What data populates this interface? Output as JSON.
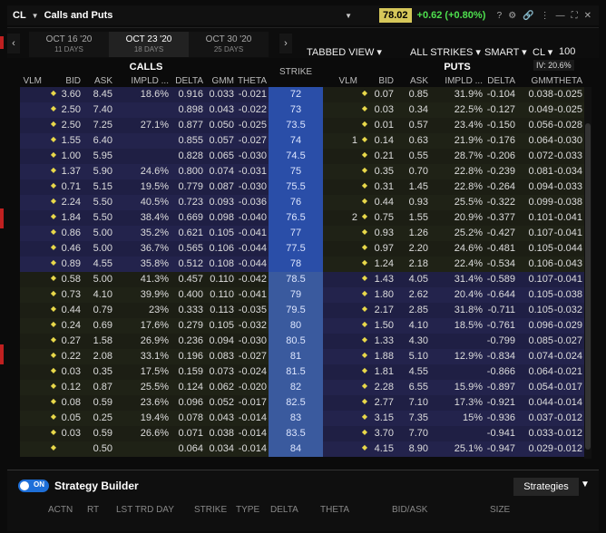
{
  "titlebar": {
    "symbol": "CL",
    "title": "Calls and Puts",
    "price": "78.02",
    "change": "+0.62 (+0.80%)"
  },
  "tabs": [
    {
      "date": "OCT 16 '20",
      "days": "11 DAYS",
      "active": false
    },
    {
      "date": "OCT 23 '20",
      "days": "18 DAYS",
      "active": true
    },
    {
      "date": "OCT 30 '20",
      "days": "25 DAYS",
      "active": false
    }
  ],
  "controls": {
    "view": "TABBED VIEW",
    "strikes": "ALL STRIKES",
    "exchange": "SMART",
    "underlying": "CL",
    "multiplier": "100",
    "iv": "IV: 20.6%"
  },
  "sections": {
    "calls": "CALLS",
    "strike": "STRIKE",
    "puts": "PUTS"
  },
  "headers": {
    "calls": [
      "VLM",
      "BID",
      "ASK",
      "IMPLD ...",
      "DELTA",
      "GMM",
      "THETA"
    ],
    "puts": [
      "VLM",
      "BID",
      "ASK",
      "IMPLD ...",
      "DELTA",
      "GMM",
      "THETA"
    ]
  },
  "rows": [
    {
      "c_bid": "3.60",
      "c_ask": "8.45",
      "c_iv": "18.6%",
      "c_delta": "0.916",
      "c_gmm": "0.033",
      "c_theta": "-0.021",
      "strike": "72",
      "p_vlm": "",
      "p_bid": "0.07",
      "p_ask": "0.85",
      "p_iv": "31.9%",
      "p_delta": "-0.104",
      "p_gmm": "0.038",
      "p_theta": "-0.025",
      "itm": true
    },
    {
      "c_bid": "2.50",
      "c_ask": "7.40",
      "c_iv": "",
      "c_delta": "0.898",
      "c_gmm": "0.043",
      "c_theta": "-0.022",
      "strike": "73",
      "p_vlm": "",
      "p_bid": "0.03",
      "p_ask": "0.34",
      "p_iv": "22.5%",
      "p_delta": "-0.127",
      "p_gmm": "0.049",
      "p_theta": "-0.025",
      "itm": true
    },
    {
      "c_bid": "2.50",
      "c_ask": "7.25",
      "c_iv": "27.1%",
      "c_delta": "0.877",
      "c_gmm": "0.050",
      "c_theta": "-0.025",
      "strike": "73.5",
      "p_vlm": "",
      "p_bid": "0.01",
      "p_ask": "0.57",
      "p_iv": "23.4%",
      "p_delta": "-0.150",
      "p_gmm": "0.056",
      "p_theta": "-0.028",
      "itm": true
    },
    {
      "c_bid": "1.55",
      "c_ask": "6.40",
      "c_iv": "",
      "c_delta": "0.855",
      "c_gmm": "0.057",
      "c_theta": "-0.027",
      "strike": "74",
      "p_vlm": "1",
      "p_bid": "0.14",
      "p_ask": "0.63",
      "p_iv": "21.9%",
      "p_delta": "-0.176",
      "p_gmm": "0.064",
      "p_theta": "-0.030",
      "itm": true
    },
    {
      "c_bid": "1.00",
      "c_ask": "5.95",
      "c_iv": "",
      "c_delta": "0.828",
      "c_gmm": "0.065",
      "c_theta": "-0.030",
      "strike": "74.5",
      "p_vlm": "",
      "p_bid": "0.21",
      "p_ask": "0.55",
      "p_iv": "28.7%",
      "p_delta": "-0.206",
      "p_gmm": "0.072",
      "p_theta": "-0.033",
      "itm": true
    },
    {
      "c_bid": "1.37",
      "c_ask": "5.90",
      "c_iv": "24.6%",
      "c_delta": "0.800",
      "c_gmm": "0.074",
      "c_theta": "-0.031",
      "strike": "75",
      "p_vlm": "",
      "p_bid": "0.35",
      "p_ask": "0.70",
      "p_iv": "22.8%",
      "p_delta": "-0.239",
      "p_gmm": "0.081",
      "p_theta": "-0.034",
      "itm": true
    },
    {
      "c_bid": "0.71",
      "c_ask": "5.15",
      "c_iv": "19.5%",
      "c_delta": "0.779",
      "c_gmm": "0.087",
      "c_theta": "-0.030",
      "strike": "75.5",
      "p_vlm": "",
      "p_bid": "0.31",
      "p_ask": "1.45",
      "p_iv": "22.8%",
      "p_delta": "-0.264",
      "p_gmm": "0.094",
      "p_theta": "-0.033",
      "itm": true
    },
    {
      "c_bid": "2.24",
      "c_ask": "5.50",
      "c_iv": "40.5%",
      "c_delta": "0.723",
      "c_gmm": "0.093",
      "c_theta": "-0.036",
      "strike": "76",
      "p_vlm": "",
      "p_bid": "0.44",
      "p_ask": "0.93",
      "p_iv": "25.5%",
      "p_delta": "-0.322",
      "p_gmm": "0.099",
      "p_theta": "-0.038",
      "itm": true
    },
    {
      "c_bid": "1.84",
      "c_ask": "5.50",
      "c_iv": "38.4%",
      "c_delta": "0.669",
      "c_gmm": "0.098",
      "c_theta": "-0.040",
      "strike": "76.5",
      "p_vlm": "2",
      "p_bid": "0.75",
      "p_ask": "1.55",
      "p_iv": "20.9%",
      "p_delta": "-0.377",
      "p_gmm": "0.101",
      "p_theta": "-0.041",
      "itm": true
    },
    {
      "c_bid": "0.86",
      "c_ask": "5.00",
      "c_iv": "35.2%",
      "c_delta": "0.621",
      "c_gmm": "0.105",
      "c_theta": "-0.041",
      "strike": "77",
      "p_vlm": "",
      "p_bid": "0.93",
      "p_ask": "1.26",
      "p_iv": "25.2%",
      "p_delta": "-0.427",
      "p_gmm": "0.107",
      "p_theta": "-0.041",
      "itm": true
    },
    {
      "c_bid": "0.46",
      "c_ask": "5.00",
      "c_iv": "36.7%",
      "c_delta": "0.565",
      "c_gmm": "0.106",
      "c_theta": "-0.044",
      "strike": "77.5",
      "p_vlm": "",
      "p_bid": "0.97",
      "p_ask": "2.20",
      "p_iv": "24.6%",
      "p_delta": "-0.481",
      "p_gmm": "0.105",
      "p_theta": "-0.044",
      "itm": true
    },
    {
      "c_bid": "0.89",
      "c_ask": "4.55",
      "c_iv": "35.8%",
      "c_delta": "0.512",
      "c_gmm": "0.108",
      "c_theta": "-0.044",
      "strike": "78",
      "p_vlm": "",
      "p_bid": "1.24",
      "p_ask": "2.18",
      "p_iv": "22.4%",
      "p_delta": "-0.534",
      "p_gmm": "0.106",
      "p_theta": "-0.043",
      "itm": true
    },
    {
      "c_bid": "0.58",
      "c_ask": "5.00",
      "c_iv": "41.3%",
      "c_delta": "0.457",
      "c_gmm": "0.110",
      "c_theta": "-0.042",
      "strike": "78.5",
      "p_vlm": "",
      "p_bid": "1.43",
      "p_ask": "4.05",
      "p_iv": "31.4%",
      "p_delta": "-0.589",
      "p_gmm": "0.107",
      "p_theta": "-0.041",
      "itm": false
    },
    {
      "c_bid": "0.73",
      "c_ask": "4.10",
      "c_iv": "39.9%",
      "c_delta": "0.400",
      "c_gmm": "0.110",
      "c_theta": "-0.041",
      "strike": "79",
      "p_vlm": "",
      "p_bid": "1.80",
      "p_ask": "2.62",
      "p_iv": "20.4%",
      "p_delta": "-0.644",
      "p_gmm": "0.105",
      "p_theta": "-0.038",
      "itm": false
    },
    {
      "c_bid": "0.44",
      "c_ask": "0.79",
      "c_iv": "23%",
      "c_delta": "0.333",
      "c_gmm": "0.113",
      "c_theta": "-0.035",
      "strike": "79.5",
      "p_vlm": "",
      "p_bid": "2.17",
      "p_ask": "2.85",
      "p_iv": "31.8%",
      "p_delta": "-0.711",
      "p_gmm": "0.105",
      "p_theta": "-0.032",
      "itm": false
    },
    {
      "c_bid": "0.24",
      "c_ask": "0.69",
      "c_iv": "17.6%",
      "c_delta": "0.279",
      "c_gmm": "0.105",
      "c_theta": "-0.032",
      "strike": "80",
      "p_vlm": "",
      "p_bid": "1.50",
      "p_ask": "4.10",
      "p_iv": "18.5%",
      "p_delta": "-0.761",
      "p_gmm": "0.096",
      "p_theta": "-0.029",
      "itm": false
    },
    {
      "c_bid": "0.27",
      "c_ask": "1.58",
      "c_iv": "26.9%",
      "c_delta": "0.236",
      "c_gmm": "0.094",
      "c_theta": "-0.030",
      "strike": "80.5",
      "p_vlm": "",
      "p_bid": "1.33",
      "p_ask": "4.30",
      "p_iv": "",
      "p_delta": "-0.799",
      "p_gmm": "0.085",
      "p_theta": "-0.027",
      "itm": false
    },
    {
      "c_bid": "0.22",
      "c_ask": "2.08",
      "c_iv": "33.1%",
      "c_delta": "0.196",
      "c_gmm": "0.083",
      "c_theta": "-0.027",
      "strike": "81",
      "p_vlm": "",
      "p_bid": "1.88",
      "p_ask": "5.10",
      "p_iv": "12.9%",
      "p_delta": "-0.834",
      "p_gmm": "0.074",
      "p_theta": "-0.024",
      "itm": false
    },
    {
      "c_bid": "0.03",
      "c_ask": "0.35",
      "c_iv": "17.5%",
      "c_delta": "0.159",
      "c_gmm": "0.073",
      "c_theta": "-0.024",
      "strike": "81.5",
      "p_vlm": "",
      "p_bid": "1.81",
      "p_ask": "4.55",
      "p_iv": "",
      "p_delta": "-0.866",
      "p_gmm": "0.064",
      "p_theta": "-0.021",
      "itm": false
    },
    {
      "c_bid": "0.12",
      "c_ask": "0.87",
      "c_iv": "25.5%",
      "c_delta": "0.124",
      "c_gmm": "0.062",
      "c_theta": "-0.020",
      "strike": "82",
      "p_vlm": "",
      "p_bid": "2.28",
      "p_ask": "6.55",
      "p_iv": "15.9%",
      "p_delta": "-0.897",
      "p_gmm": "0.054",
      "p_theta": "-0.017",
      "itm": false
    },
    {
      "c_bid": "0.08",
      "c_ask": "0.59",
      "c_iv": "23.6%",
      "c_delta": "0.096",
      "c_gmm": "0.052",
      "c_theta": "-0.017",
      "strike": "82.5",
      "p_vlm": "",
      "p_bid": "2.77",
      "p_ask": "7.10",
      "p_iv": "17.3%",
      "p_delta": "-0.921",
      "p_gmm": "0.044",
      "p_theta": "-0.014",
      "itm": false
    },
    {
      "c_bid": "0.05",
      "c_ask": "0.25",
      "c_iv": "19.4%",
      "c_delta": "0.078",
      "c_gmm": "0.043",
      "c_theta": "-0.014",
      "strike": "83",
      "p_vlm": "",
      "p_bid": "3.15",
      "p_ask": "7.35",
      "p_iv": "15%",
      "p_delta": "-0.936",
      "p_gmm": "0.037",
      "p_theta": "-0.012",
      "itm": false
    },
    {
      "c_bid": "0.03",
      "c_ask": "0.59",
      "c_iv": "26.6%",
      "c_delta": "0.071",
      "c_gmm": "0.038",
      "c_theta": "-0.014",
      "strike": "83.5",
      "p_vlm": "",
      "p_bid": "3.70",
      "p_ask": "7.70",
      "p_iv": "",
      "p_delta": "-0.941",
      "p_gmm": "0.033",
      "p_theta": "-0.012",
      "itm": false
    },
    {
      "c_bid": "",
      "c_ask": "0.50",
      "c_iv": "",
      "c_delta": "0.064",
      "c_gmm": "0.034",
      "c_theta": "-0.014",
      "strike": "84",
      "p_vlm": "",
      "p_bid": "4.15",
      "p_ask": "8.90",
      "p_iv": "25.1%",
      "p_delta": "-0.947",
      "p_gmm": "0.029",
      "p_theta": "-0.012",
      "itm": false
    }
  ],
  "strategy": {
    "toggle": "ON",
    "title": "Strategy Builder",
    "button": "Strategies",
    "columns": [
      "ACTN",
      "RT",
      "LST TRD DAY",
      "STRIKE",
      "TYPE",
      "DELTA",
      "THETA",
      "BID/ASK",
      "SIZE"
    ]
  },
  "colors": {
    "accent": "#2a4ea8",
    "positive": "#4ee04e",
    "price_bg": "#d6c75a"
  }
}
